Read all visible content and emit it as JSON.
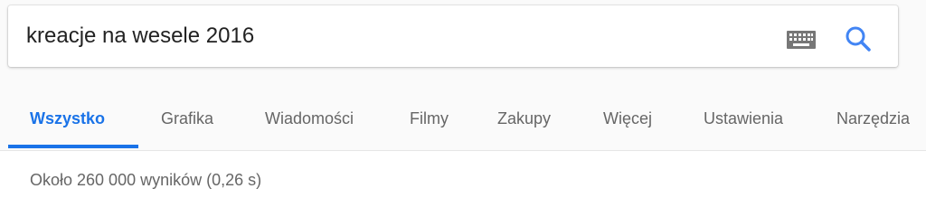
{
  "search": {
    "query": "kreacje na wesele 2016"
  },
  "icons": {
    "keyboard": "keyboard-icon",
    "search": "search-icon"
  },
  "tabs": [
    {
      "label": "Wszystko",
      "active": true
    },
    {
      "label": "Grafika",
      "active": false
    },
    {
      "label": "Wiadomości",
      "active": false
    },
    {
      "label": "Filmy",
      "active": false
    },
    {
      "label": "Zakupy",
      "active": false
    },
    {
      "label": "Więcej",
      "active": false
    },
    {
      "label": "Ustawienia",
      "active": false
    },
    {
      "label": "Narzędzia",
      "active": false
    }
  ],
  "results": {
    "stats": "Około 260 000 wyników (0,26 s)"
  },
  "colors": {
    "accent": "#1a73e8",
    "tab_text": "#666666",
    "background": "#fafafa"
  }
}
